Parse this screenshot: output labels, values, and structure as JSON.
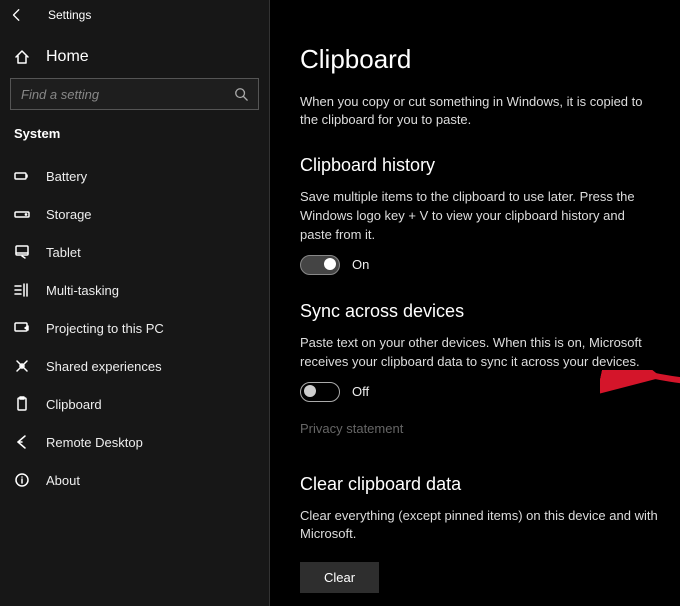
{
  "titlebar": {
    "title": "Settings"
  },
  "home": {
    "label": "Home"
  },
  "search": {
    "placeholder": "Find a setting"
  },
  "category": "System",
  "nav": [
    {
      "id": "battery",
      "label": "Battery"
    },
    {
      "id": "storage",
      "label": "Storage"
    },
    {
      "id": "tablet",
      "label": "Tablet"
    },
    {
      "id": "multitasking",
      "label": "Multi-tasking"
    },
    {
      "id": "projecting",
      "label": "Projecting to this PC"
    },
    {
      "id": "shared",
      "label": "Shared experiences"
    },
    {
      "id": "clipboard",
      "label": "Clipboard"
    },
    {
      "id": "remote",
      "label": "Remote Desktop"
    },
    {
      "id": "about",
      "label": "About"
    }
  ],
  "page": {
    "title": "Clipboard",
    "intro": "When you copy or cut something in Windows, it is copied to the clipboard for you to paste.",
    "history": {
      "heading": "Clipboard history",
      "desc": "Save multiple items to the clipboard to use later. Press the Windows logo key + V to view your clipboard history and paste from it.",
      "state_label": "On",
      "on": true
    },
    "sync": {
      "heading": "Sync across devices",
      "desc": "Paste text on your other devices. When this is on, Microsoft receives your clipboard data to sync it across your devices.",
      "state_label": "Off",
      "on": false,
      "privacy_link": "Privacy statement"
    },
    "clear": {
      "heading": "Clear clipboard data",
      "desc": "Clear everything (except pinned items) on this device and with Microsoft.",
      "button": "Clear"
    }
  }
}
